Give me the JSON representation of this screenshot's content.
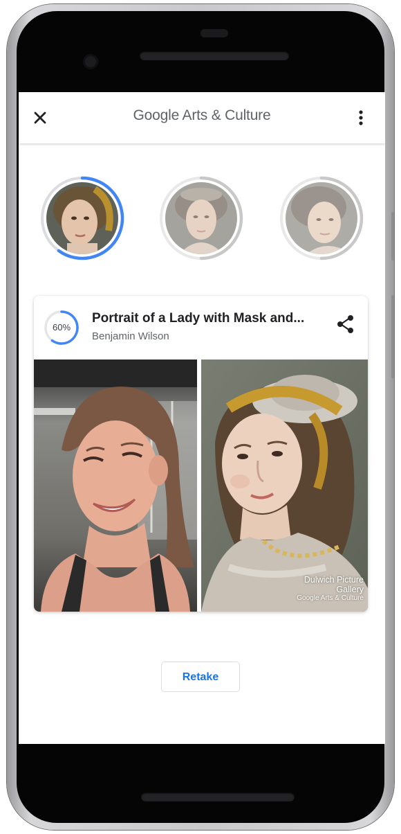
{
  "app_bar": {
    "title_brand": "Google",
    "title_rest": " Arts & Culture",
    "close_icon": "close-icon",
    "menu_icon": "more-vert-icon"
  },
  "matches": [
    {
      "name": "match-1",
      "selected": true,
      "ring_progress": 0.6
    },
    {
      "name": "match-2",
      "selected": false
    },
    {
      "name": "match-3",
      "selected": false
    }
  ],
  "result": {
    "similarity": "60%",
    "similarity_fraction": 0.6,
    "title": "Portrait of a Lady with Mask and...",
    "artist": "Benjamin Wilson",
    "share_icon": "share-icon",
    "credit_line1": "Dulwich Picture",
    "credit_line2": "Gallery",
    "credit_line3": "Google Arts & Culture"
  },
  "retake_label": "Retake",
  "colors": {
    "accent_blue": "#4285f4",
    "button_text_blue": "#1a73e8",
    "ring_gray": "#dadce0"
  }
}
